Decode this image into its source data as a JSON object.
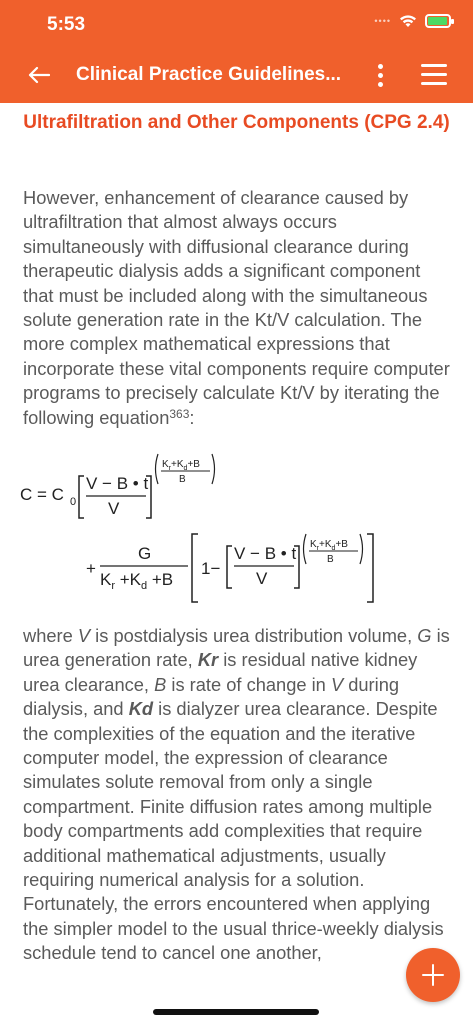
{
  "status": {
    "time": "5:53"
  },
  "nav": {
    "title": "Clinical Practice Guidelines..."
  },
  "section": {
    "title": "Ultrafiltration and Other Components (CPG 2.4)"
  },
  "paragraph1": {
    "text": "However, enhancement of clearance caused by ultrafiltration that almost always occurs simultaneously with diffusional clearance during therapeutic dialysis adds a significant component that must be included along with the simultaneous solute generation rate in the Kt/V calculation. The more complex mathematical expressions that incorporate these vital components require computer programs to precisely calculate Kt/V by iterating the following equation",
    "ref": "363",
    "end": ":"
  },
  "equation": {
    "lhs": "C = C",
    "c0_sub": "0",
    "frac1_num": "V − B • t",
    "frac1_den": "V",
    "exponent_num": "K",
    "exponent_den": "B",
    "g": "G",
    "den2": "K",
    "one_minus": "1−"
  },
  "paragraph2": {
    "t1": "where ",
    "v": "V",
    "t2": " is postdialysis urea distribution volume, ",
    "g": "G",
    "t3": " is urea generation rate, ",
    "kr": "Kr",
    "t4": " is residual native kidney urea clearance, ",
    "b": "B",
    "t5": " is rate of change in ",
    "v2": "V",
    "t6": " during dialysis, and ",
    "kd": "Kd",
    "t7": " is dialyzer urea clearance. Despite the complexities of the equation and the iterative computer model, the expression of clearance simulates solute removal from only a single compartment. Finite diffusion rates among multiple body compartments add complexities that require additional mathematical adjustments, usually requiring numerical analysis for a solution. Fortunately, the errors encountered when applying the simpler model to the usual thrice-weekly dialysis schedule tend to cancel one another,"
  },
  "colors": {
    "accent": "#F0602C",
    "title": "#E84B23",
    "battery": "#4CD964"
  },
  "icons": [
    "wifi-icon",
    "battery-icon",
    "back-arrow-icon",
    "more-vertical-icon",
    "hamburger-menu-icon",
    "plus-icon"
  ]
}
